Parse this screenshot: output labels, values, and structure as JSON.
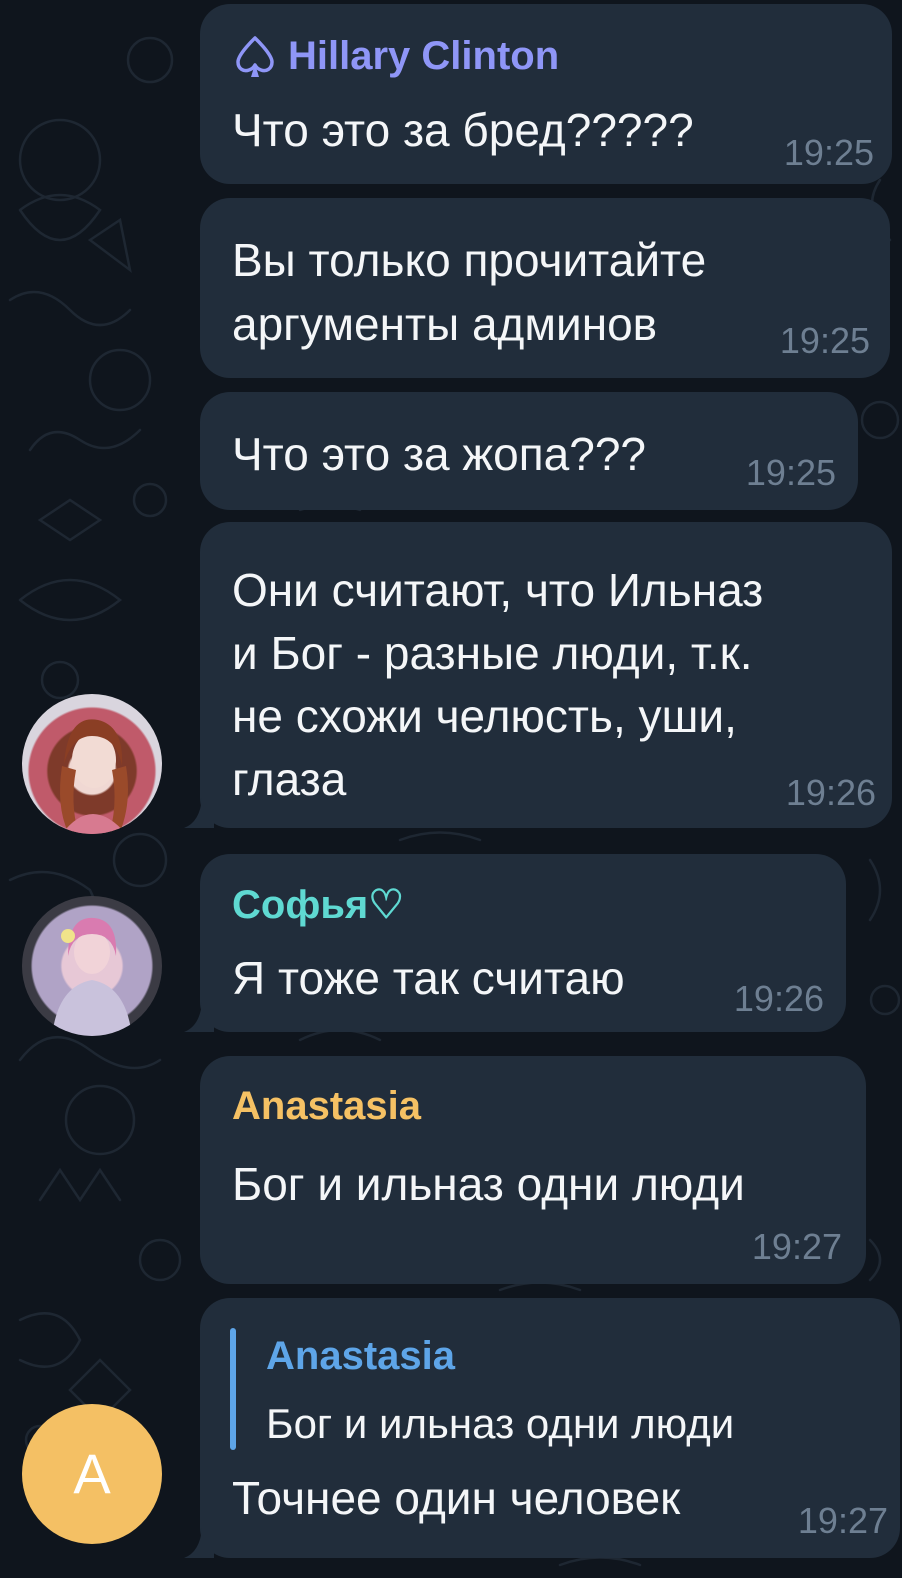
{
  "colors": {
    "background": "#0f151d",
    "bubble": "#212d3b",
    "text": "#f4f6f8",
    "time": "#6e7f92",
    "hillary_name": "#8f96f7",
    "sofya_name": "#5fd9d2",
    "anastasia_name": "#f5c164",
    "reply_accent": "#5ea5e8",
    "avatar_a_bg": "#f4c064"
  },
  "messages": [
    {
      "sender": "Hillary Clinton",
      "sender_icon": "spade-icon",
      "text": "Что это за бред?????",
      "time": "19:25"
    },
    {
      "lines": [
        "Вы только прочитайте",
        "аргументы админов"
      ],
      "time": "19:25"
    },
    {
      "text": "Что это за жопа???",
      "time": "19:25"
    },
    {
      "lines": [
        "Они считают, что Ильназ",
        "и Бог - разные люди, т.к.",
        "не схожи челюсть, уши,",
        "глаза"
      ],
      "time": "19:26",
      "avatar": "photo-avatar"
    },
    {
      "sender": "Софья♡",
      "text": "Я тоже так считаю",
      "time": "19:26",
      "avatar": "photo-avatar"
    },
    {
      "sender": "Anastasia",
      "text": "Бог и ильназ одни люди",
      "time": "19:27"
    },
    {
      "reply": {
        "name": "Anastasia",
        "text": "Бог и ильназ одни люди"
      },
      "text": "Точнее один человек",
      "time": "19:27",
      "avatar_letter": "A"
    }
  ]
}
